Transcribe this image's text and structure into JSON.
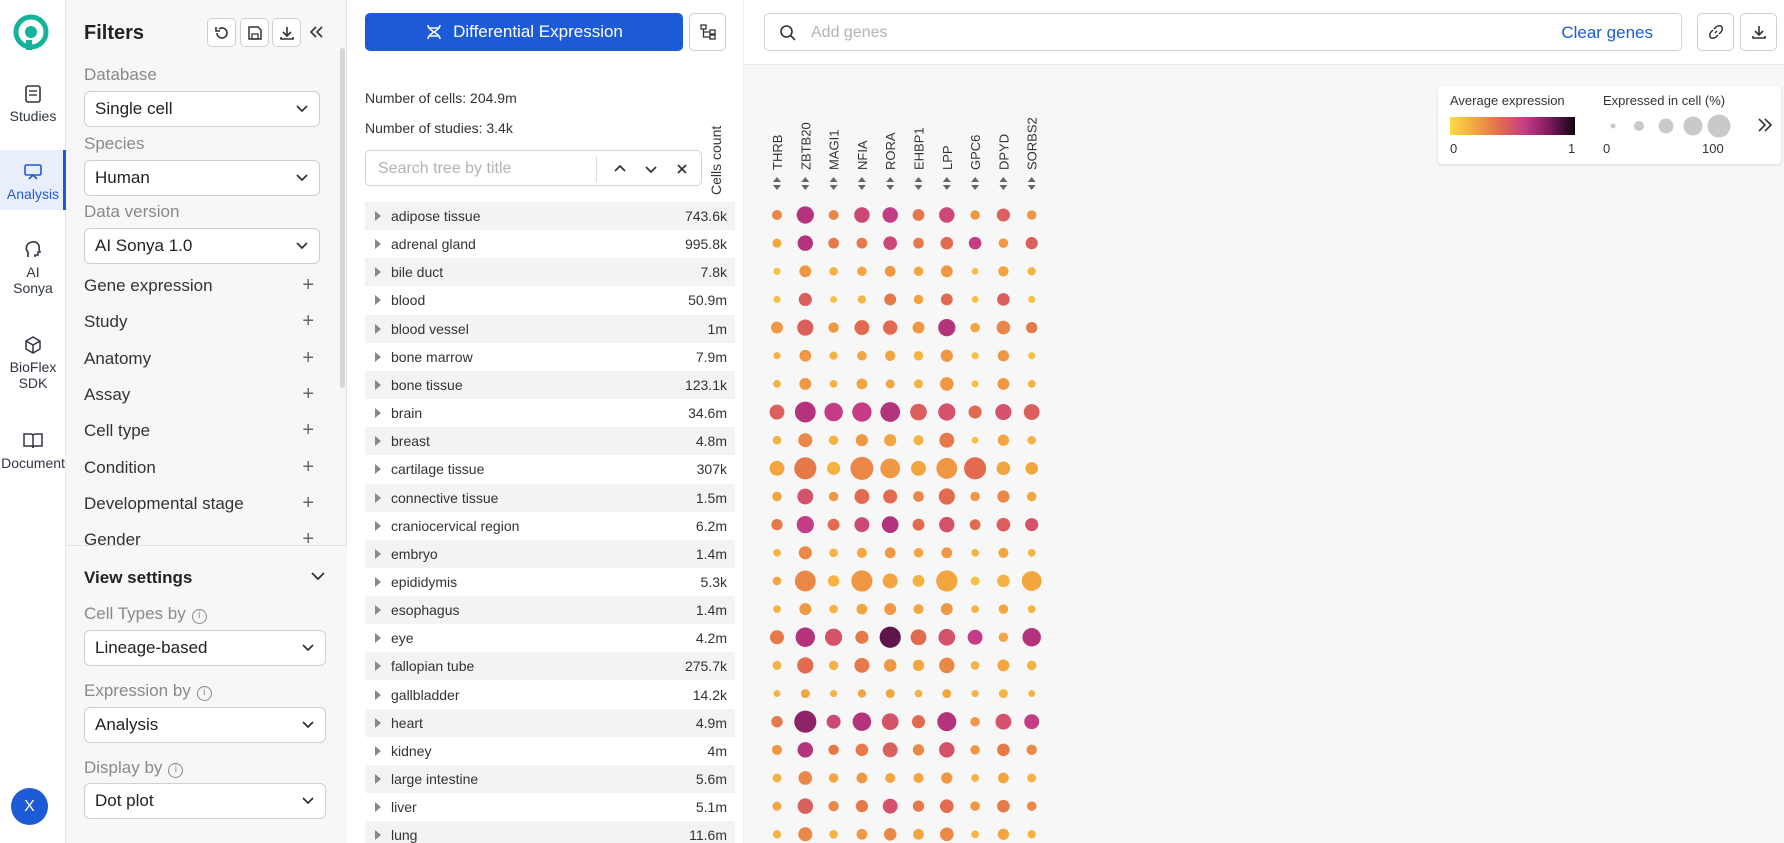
{
  "rail": {
    "items": [
      {
        "label": "Studies",
        "icon": "studies-icon"
      },
      {
        "label": "Analysis",
        "icon": "analysis-icon",
        "active": true
      },
      {
        "label": "AI Sonya",
        "icon": "ai-sonya-icon"
      },
      {
        "label": "BioFlex SDK",
        "icon": "sdk-icon"
      },
      {
        "label": "Document",
        "icon": "document-icon"
      }
    ],
    "avatar": "X"
  },
  "filters": {
    "title": "Filters",
    "database_label": "Database",
    "database_value": "Single cell",
    "species_label": "Species",
    "species_value": "Human",
    "version_label": "Data version",
    "version_value": "AI Sonya 1.0",
    "rows": [
      "Gene expression",
      "Study",
      "Anatomy",
      "Assay",
      "Cell type",
      "Condition",
      "Developmental stage",
      "Gender"
    ]
  },
  "view_settings": {
    "title": "View settings",
    "cell_types_label": "Cell Types by",
    "cell_types_value": "Lineage-based",
    "expression_label": "Expression by",
    "expression_value": "Analysis",
    "display_label": "Display by",
    "display_value": "Dot plot"
  },
  "tree": {
    "de_button": "Differential Expression",
    "num_cells": "Number of cells: 204.9m",
    "num_studies": "Number of studies: 3.4k",
    "search_placeholder": "Search tree by title",
    "cells_count_header": "Cells count",
    "rows": [
      {
        "name": "adipose tissue",
        "count": "743.6k"
      },
      {
        "name": "adrenal gland",
        "count": "995.8k"
      },
      {
        "name": "bile duct",
        "count": "7.8k"
      },
      {
        "name": "blood",
        "count": "50.9m"
      },
      {
        "name": "blood vessel",
        "count": "1m"
      },
      {
        "name": "bone marrow",
        "count": "7.9m"
      },
      {
        "name": "bone tissue",
        "count": "123.1k"
      },
      {
        "name": "brain",
        "count": "34.6m"
      },
      {
        "name": "breast",
        "count": "4.8m"
      },
      {
        "name": "cartilage tissue",
        "count": "307k"
      },
      {
        "name": "connective tissue",
        "count": "1.5m"
      },
      {
        "name": "craniocervical region",
        "count": "6.2m"
      },
      {
        "name": "embryo",
        "count": "1.4m"
      },
      {
        "name": "epididymis",
        "count": "5.3k"
      },
      {
        "name": "esophagus",
        "count": "1.4m"
      },
      {
        "name": "eye",
        "count": "4.2m"
      },
      {
        "name": "fallopian tube",
        "count": "275.7k"
      },
      {
        "name": "gallbladder",
        "count": "14.2k"
      },
      {
        "name": "heart",
        "count": "4.9m"
      },
      {
        "name": "kidney",
        "count": "4m"
      },
      {
        "name": "large intestine",
        "count": "5.6m"
      },
      {
        "name": "liver",
        "count": "5.1m"
      },
      {
        "name": "lung",
        "count": "11.6m"
      }
    ]
  },
  "topbar": {
    "gene_placeholder": "Add genes",
    "clear_genes": "Clear genes"
  },
  "legend": {
    "avg_title": "Average expression",
    "avg_min": "0",
    "avg_max": "1",
    "pct_title": "Expressed in cell (%)",
    "pct_min": "0",
    "pct_max": "100"
  },
  "colors": {
    "accent": "#1d5bd6",
    "scale": [
      "#fad94a",
      "#f3a63f",
      "#e26a4e",
      "#c53c86",
      "#7c1a5d",
      "#0d0712"
    ]
  },
  "chart_data": {
    "type": "dot",
    "genes": [
      "THRB",
      "ZBTB20",
      "MAGI1",
      "NFIA",
      "RORA",
      "EHBP1",
      "LPP",
      "GPC6",
      "DPYD",
      "SORBS2"
    ],
    "rows": [
      "adipose tissue",
      "adrenal gland",
      "bile duct",
      "blood",
      "blood vessel",
      "bone marrow",
      "bone tissue",
      "brain",
      "breast",
      "cartilage tissue",
      "connective tissue",
      "craniocervical region",
      "embryo",
      "epididymis",
      "esophagus",
      "eye",
      "fallopian tube",
      "gallbladder",
      "heart",
      "kidney",
      "large intestine",
      "liver",
      "lung"
    ],
    "avg_expression": [
      [
        0.3,
        0.65,
        0.3,
        0.55,
        0.6,
        0.35,
        0.55,
        0.25,
        0.45,
        0.25
      ],
      [
        0.2,
        0.65,
        0.35,
        0.35,
        0.55,
        0.35,
        0.4,
        0.6,
        0.25,
        0.45
      ],
      [
        0.1,
        0.25,
        0.15,
        0.2,
        0.25,
        0.2,
        0.25,
        0.1,
        0.2,
        0.15
      ],
      [
        0.1,
        0.45,
        0.1,
        0.15,
        0.35,
        0.2,
        0.4,
        0.1,
        0.45,
        0.1
      ],
      [
        0.25,
        0.45,
        0.25,
        0.4,
        0.4,
        0.25,
        0.65,
        0.2,
        0.3,
        0.35
      ],
      [
        0.15,
        0.25,
        0.15,
        0.2,
        0.2,
        0.15,
        0.25,
        0.1,
        0.25,
        0.1
      ],
      [
        0.15,
        0.25,
        0.15,
        0.2,
        0.2,
        0.15,
        0.25,
        0.1,
        0.25,
        0.15
      ],
      [
        0.45,
        0.65,
        0.6,
        0.6,
        0.65,
        0.45,
        0.5,
        0.4,
        0.5,
        0.45
      ],
      [
        0.15,
        0.3,
        0.15,
        0.25,
        0.2,
        0.15,
        0.35,
        0.1,
        0.2,
        0.15
      ],
      [
        0.2,
        0.35,
        0.15,
        0.3,
        0.25,
        0.2,
        0.25,
        0.4,
        0.2,
        0.2
      ],
      [
        0.2,
        0.5,
        0.25,
        0.4,
        0.4,
        0.3,
        0.4,
        0.25,
        0.3,
        0.2
      ],
      [
        0.35,
        0.6,
        0.4,
        0.55,
        0.65,
        0.4,
        0.5,
        0.4,
        0.45,
        0.5
      ],
      [
        0.15,
        0.3,
        0.15,
        0.2,
        0.25,
        0.2,
        0.25,
        0.15,
        0.2,
        0.15
      ],
      [
        0.2,
        0.3,
        0.15,
        0.25,
        0.2,
        0.15,
        0.2,
        0.1,
        0.15,
        0.2
      ],
      [
        0.15,
        0.25,
        0.15,
        0.2,
        0.25,
        0.2,
        0.25,
        0.15,
        0.2,
        0.15
      ],
      [
        0.35,
        0.65,
        0.5,
        0.35,
        0.85,
        0.4,
        0.5,
        0.6,
        0.2,
        0.65
      ],
      [
        0.15,
        0.4,
        0.15,
        0.35,
        0.25,
        0.2,
        0.3,
        0.15,
        0.2,
        0.15
      ],
      [
        0.15,
        0.2,
        0.15,
        0.2,
        0.2,
        0.15,
        0.2,
        0.15,
        0.15,
        0.15
      ],
      [
        0.35,
        0.75,
        0.55,
        0.65,
        0.5,
        0.4,
        0.65,
        0.25,
        0.5,
        0.6
      ],
      [
        0.25,
        0.65,
        0.35,
        0.35,
        0.45,
        0.3,
        0.5,
        0.25,
        0.35,
        0.3
      ],
      [
        0.15,
        0.3,
        0.2,
        0.25,
        0.2,
        0.2,
        0.25,
        0.15,
        0.2,
        0.15
      ],
      [
        0.2,
        0.45,
        0.3,
        0.35,
        0.5,
        0.35,
        0.4,
        0.25,
        0.35,
        0.3
      ],
      [
        0.15,
        0.3,
        0.15,
        0.25,
        0.3,
        0.2,
        0.3,
        0.15,
        0.2,
        0.15
      ]
    ],
    "pct_expressed": [
      [
        28,
        68,
        28,
        58,
        58,
        38,
        58,
        25,
        45,
        25
      ],
      [
        22,
        58,
        32,
        32,
        48,
        32,
        42,
        42,
        25,
        40
      ],
      [
        12,
        38,
        20,
        25,
        32,
        25,
        38,
        10,
        30,
        18
      ],
      [
        12,
        45,
        10,
        18,
        38,
        25,
        38,
        10,
        42,
        12
      ],
      [
        38,
        62,
        30,
        55,
        52,
        38,
        68,
        25,
        48,
        35
      ],
      [
        12,
        38,
        18,
        25,
        30,
        25,
        40,
        12,
        35,
        12
      ],
      [
        15,
        38,
        15,
        32,
        22,
        22,
        48,
        12,
        38,
        15
      ],
      [
        55,
        88,
        75,
        80,
        82,
        65,
        68,
        45,
        62,
        60
      ],
      [
        20,
        50,
        25,
        40,
        40,
        28,
        55,
        10,
        35,
        20
      ],
      [
        55,
        95,
        45,
        100,
        82,
        55,
        88,
        95,
        48,
        42
      ],
      [
        25,
        60,
        25,
        55,
        50,
        32,
        62,
        25,
        40,
        25
      ],
      [
        35,
        68,
        38,
        55,
        65,
        38,
        58,
        32,
        48,
        45
      ],
      [
        15,
        45,
        20,
        28,
        32,
        25,
        32,
        15,
        28,
        15
      ],
      [
        20,
        88,
        35,
        90,
        55,
        38,
        90,
        22,
        42,
        82
      ],
      [
        15,
        38,
        20,
        32,
        38,
        28,
        38,
        15,
        25,
        15
      ],
      [
        50,
        80,
        68,
        45,
        90,
        60,
        65,
        55,
        25,
        75
      ],
      [
        22,
        62,
        25,
        55,
        42,
        35,
        58,
        20,
        38,
        25
      ],
      [
        10,
        22,
        12,
        18,
        22,
        15,
        22,
        12,
        22,
        10
      ],
      [
        35,
        95,
        50,
        75,
        65,
        45,
        78,
        25,
        60,
        55
      ],
      [
        28,
        58,
        30,
        42,
        55,
        35,
        58,
        25,
        42,
        30
      ],
      [
        22,
        48,
        25,
        32,
        28,
        28,
        35,
        15,
        32,
        22
      ],
      [
        22,
        58,
        30,
        40,
        55,
        35,
        48,
        25,
        42,
        25
      ],
      [
        18,
        50,
        20,
        32,
        42,
        32,
        48,
        15,
        35,
        18
      ]
    ]
  }
}
